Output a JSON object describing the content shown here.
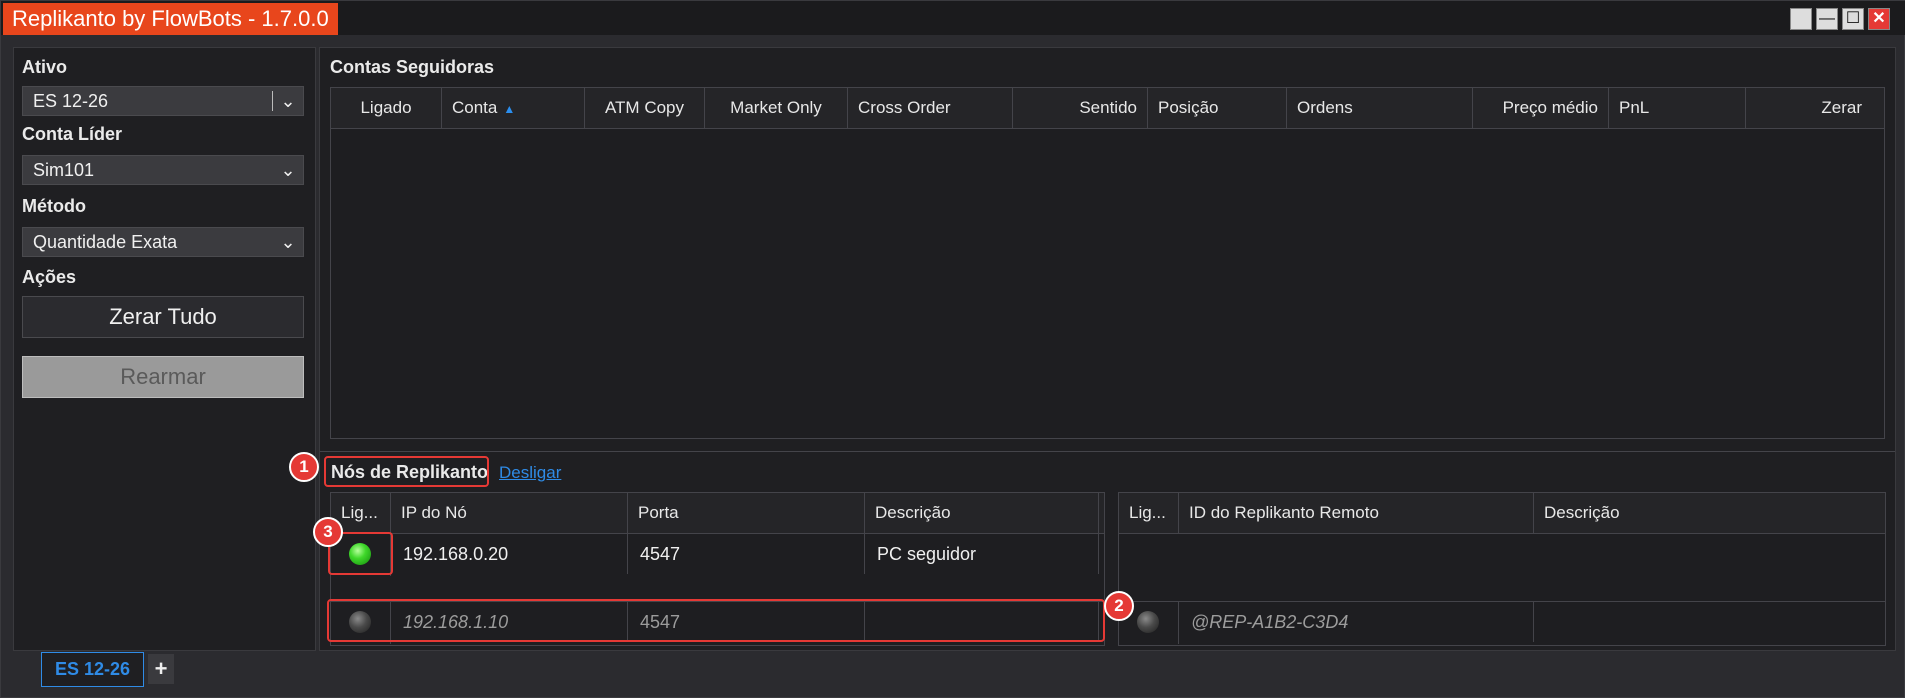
{
  "window": {
    "title": "Replikanto by FlowBots - 1.7.0.0",
    "controls": [
      "",
      "—",
      "☐",
      "✕"
    ]
  },
  "left": {
    "ativo_label": "Ativo",
    "ativo_value": "ES 12-26",
    "conta_lider_label": "Conta Líder",
    "conta_lider_value": "Sim101",
    "metodo_label": "Método",
    "metodo_value": "Quantidade Exata",
    "acoes_label": "Ações",
    "zerar_tudo": "Zerar Tudo",
    "rearmar": "Rearmar"
  },
  "contas": {
    "title": "Contas Seguidoras",
    "columns": [
      "Ligado",
      "Conta",
      "ATM Copy",
      "Market Only",
      "Cross Order",
      "Sentido",
      "Posição",
      "Ordens",
      "Preço médio",
      "PnL",
      "Zerar"
    ]
  },
  "nos": {
    "title": "Nós de Replikanto",
    "desligar": "Desligar",
    "local_columns": [
      "Lig...",
      "IP do Nó",
      "Porta",
      "Descrição"
    ],
    "local_rows": [
      {
        "ip": "192.168.0.20",
        "porta": "4547",
        "descricao": "PC seguidor",
        "status": "on"
      },
      {
        "ip": "192.168.1.10",
        "porta": "4547",
        "descricao": "",
        "status": "off"
      }
    ],
    "remote_columns": [
      "Lig...",
      "ID do Replikanto Remoto",
      "Descrição"
    ],
    "remote_rows": [
      {
        "id": "@REP-A1B2-C3D4",
        "descricao": "",
        "status": "off"
      }
    ]
  },
  "badges": [
    "1",
    "2",
    "3"
  ],
  "tabs": {
    "active": "ES 12-26",
    "add": "+"
  },
  "colors": {
    "accent": "#e8461c",
    "link": "#2f8be6",
    "annotation": "#e53935"
  }
}
